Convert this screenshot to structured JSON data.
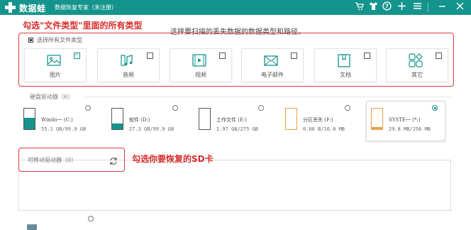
{
  "titlebar": {
    "app_name": "数据蛙",
    "subtitle": "数据恢复专家（未注册）",
    "bg_color": "#14948c",
    "icons": [
      "cart-icon",
      "shirt-icon",
      "help-icon",
      "plus-icon",
      "menu-icon",
      "minimize-icon",
      "close-icon"
    ]
  },
  "annotations": {
    "top": "勾选\"文件类型\"里面的所有类型",
    "sd": "勾选你要恢复的SD卡",
    "color": "#d92b2b"
  },
  "hint": "选择要扫描的丢失数据的数据类型和路径。",
  "select_all": {
    "label": "选择所有文件类型",
    "checked": true
  },
  "file_types": [
    {
      "label": "图片",
      "icon": "image-icon",
      "checked": true
    },
    {
      "label": "音频",
      "icon": "music-icon",
      "checked": false
    },
    {
      "label": "视频",
      "icon": "video-icon",
      "checked": false
    },
    {
      "label": "电子邮件",
      "icon": "email-icon",
      "checked": false
    },
    {
      "label": "文档",
      "icon": "document-icon",
      "checked": false
    },
    {
      "label": "其它",
      "icon": "other-icon",
      "checked": false
    }
  ],
  "hard_drives": {
    "title": "硬盘驱动器（6）",
    "items": [
      {
        "name": "Windo一 (C:)",
        "size": "55.1 GB/99.9 GB",
        "fill": 0.55,
        "style": "teal",
        "selected": false
      },
      {
        "name": "软件 (D:)",
        "size": "27.3 GB/99.9 GB",
        "fill": 0.27,
        "style": "teal",
        "selected": false
      },
      {
        "name": "工作文件 (E:)",
        "size": "1.97 GB/275 GB",
        "fill": 0.01,
        "style": "teal",
        "selected": false
      },
      {
        "name": "分区丢失 (F:)",
        "size": "0.00  B/16.0 MB",
        "fill": 0.0,
        "style": "orange",
        "selected": false
      },
      {
        "name": "SYSTE一 (*:)",
        "size": "29.8 MB/256 MB",
        "fill": 0.12,
        "style": "orange",
        "selected": true
      }
    ]
  },
  "removable": {
    "title": "可移动驱动器（0）"
  }
}
